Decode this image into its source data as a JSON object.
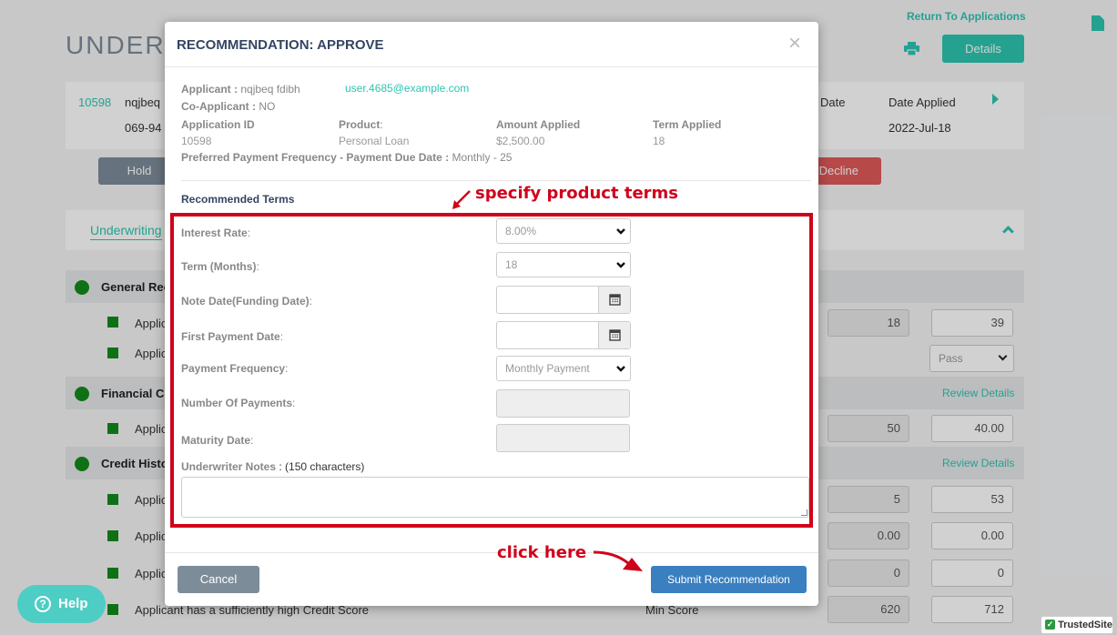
{
  "colors": {
    "accent": "#2ec5b0",
    "red_annotation": "#d0021b",
    "decline": "#e05a5a",
    "hold": "#7d8c99",
    "submit": "#3a7fc0",
    "status_green": "#138a1a"
  },
  "background": {
    "return_link": "Return To Applications",
    "page_title": "UNDERW",
    "details_button": "Details",
    "app_id": "10598",
    "applicant_short": "nqjbeq",
    "phone_short": "069-94",
    "date_header": "Date",
    "date_applied_label": "Date Applied",
    "date_applied_value": "2022-Jul-18",
    "hold_button": "Hold",
    "decline_button": "Decline",
    "underwriting_tab": "Underwriting",
    "sections": [
      {
        "label": "General Req"
      },
      {
        "label": "Financial Co",
        "link": "Review Details"
      },
      {
        "label": "Credit Histor",
        "link": "Review Details"
      }
    ],
    "row_prefix": "Applic",
    "row_values": [
      {
        "a": "18",
        "b": "39"
      },
      {
        "select": "Pass"
      },
      {
        "a": "50",
        "b": "40.00"
      },
      {
        "a": "5",
        "b": "53"
      },
      {
        "a": "0.00",
        "b": "0.00"
      },
      {
        "a": "0",
        "b": "0"
      },
      {
        "a": "620",
        "b": "712"
      }
    ],
    "last_row_label": "Applicant has a sufficiently high Credit Score",
    "last_row_type": "Min Score",
    "help_button": "Help",
    "trusted_site": "TrustedSite"
  },
  "modal": {
    "title": "RECOMMENDATION: APPROVE",
    "close": "×",
    "applicant_label": "Applicant",
    "applicant_value": "nqjbeq fdibh",
    "applicant_email": "user.4685@example.com",
    "coapplicant_label": "Co-Applicant",
    "coapplicant_value": "NO",
    "app_id_label": "Application ID",
    "app_id_value": "10598",
    "product_label": "Product",
    "product_value": "Personal Loan",
    "amount_label": "Amount Applied",
    "amount_value": "$2,500.00",
    "term_label": "Term Applied",
    "term_value": "18",
    "pref_label": "Preferred Payment Frequency - Payment Due Date :",
    "pref_value": "Monthly - 25",
    "recommended_terms": "Recommended Terms",
    "fields": {
      "interest_rate_label": "Interest Rate",
      "interest_rate_value": "8.00%",
      "term_label": "Term (Months)",
      "term_value": "18",
      "note_date_label": "Note Date(Funding Date)",
      "first_payment_label": "First Payment Date",
      "frequency_label": "Payment Frequency",
      "frequency_value": "Monthly Payment",
      "num_payments_label": "Number Of Payments",
      "maturity_label": "Maturity Date",
      "notes_label": "Underwriter Notes",
      "notes_hint": ": (150 characters)"
    },
    "cancel_button": "Cancel",
    "submit_button": "Submit Recommendation"
  },
  "annotations": {
    "terms": "specify product terms",
    "click": "click here"
  }
}
